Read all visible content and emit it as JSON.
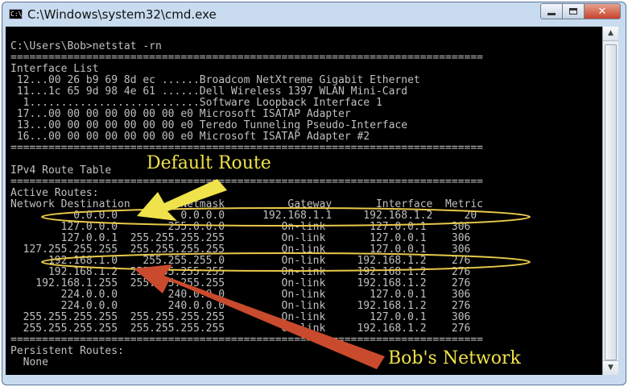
{
  "window": {
    "title": "C:\\Windows\\system32\\cmd.exe",
    "app_icon_text": "C:\\",
    "controls": {
      "close_glyph": "✕"
    }
  },
  "console": {
    "lines": [
      "",
      "C:\\Users\\Bob>netstat -rn",
      "===========================================================================",
      "Interface List",
      " 12...00 26 b9 69 8d ec ......Broadcom NetXtreme Gigabit Ethernet",
      " 11...1c 65 9d 98 4e 61 ......Dell Wireless 1397 WLAN Mini-Card",
      "  1...........................Software Loopback Interface 1",
      " 17...00 00 00 00 00 00 00 e0 Microsoft ISATAP Adapter",
      " 13...00 00 00 00 00 00 00 e0 Teredo Tunneling Pseudo-Interface",
      " 16...00 00 00 00 00 00 00 e0 Microsoft ISATAP Adapter #2",
      "===========================================================================",
      "",
      "IPv4 Route Table",
      "===========================================================================",
      "Active Routes:",
      "Network Destination        Netmask          Gateway       Interface  Metric",
      "          0.0.0.0          0.0.0.0      192.168.1.1     192.168.1.2     20",
      "        127.0.0.0        255.0.0.0         On-link       127.0.0.1    306",
      "        127.0.0.1  255.255.255.255         On-link       127.0.0.1    306",
      "  127.255.255.255  255.255.255.255         On-link       127.0.0.1    306",
      "      192.168.1.0    255.255.255.0         On-link     192.168.1.2    276",
      "      192.168.1.2  255.255.255.255         On-link     192.168.1.2    276",
      "    192.168.1.255  255.255.255.255         On-link     192.168.1.2    276",
      "        224.0.0.0        240.0.0.0         On-link       127.0.0.1    306",
      "        224.0.0.0        240.0.0.0         On-link     192.168.1.2    276",
      "  255.255.255.255  255.255.255.255         On-link       127.0.0.1    306",
      "  255.255.255.255  255.255.255.255         On-link     192.168.1.2    276",
      "===========================================================================",
      "Persistent Routes:",
      "  None"
    ]
  },
  "annotations": {
    "default_route_label": "Default Route",
    "bobs_network_label": "Bob's Network",
    "default_route_color": "#f0e24a",
    "bobs_network_color": "#c94a2c",
    "highlight_color": "#e8c84a"
  },
  "scrollbar": {
    "up_glyph": "▲",
    "down_glyph": "▼"
  }
}
